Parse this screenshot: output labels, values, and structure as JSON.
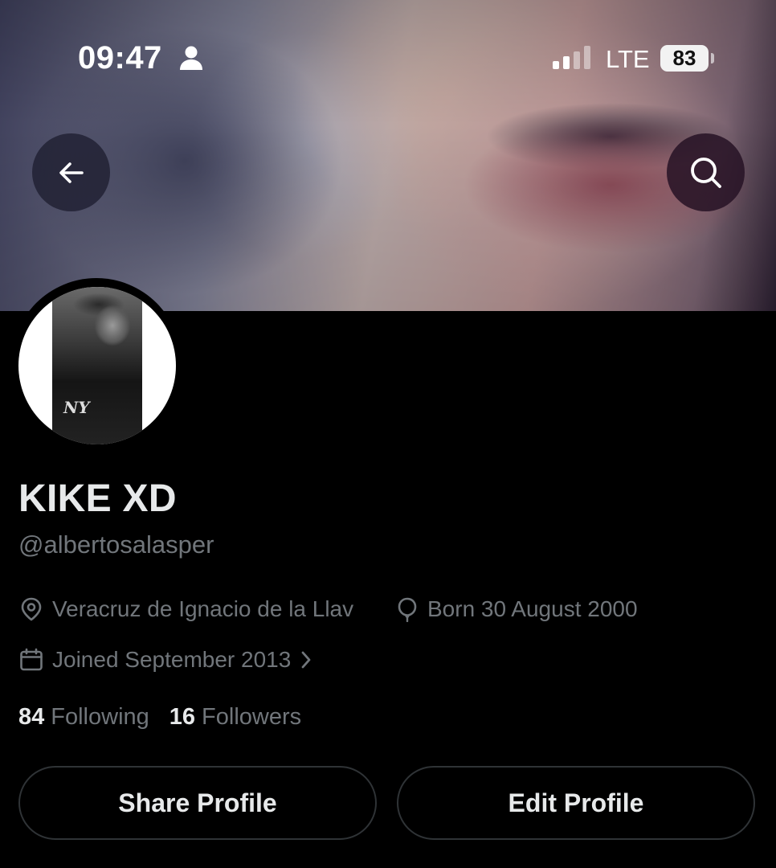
{
  "status_bar": {
    "time": "09:47",
    "network": "LTE",
    "battery": "83"
  },
  "icons": {
    "back": "arrow-left-icon",
    "search": "search-icon",
    "location": "location-pin-icon",
    "birthday": "balloon-icon",
    "joined": "calendar-icon",
    "person": "person-icon",
    "signal": "signal-icon"
  },
  "profile": {
    "display_name": "KIKE XD",
    "handle": "@albertosalasper",
    "location": "Veracruz de Ignacio de la Llav",
    "born": "Born 30 August 2000",
    "joined": "Joined September 2013"
  },
  "stats": {
    "following_count": "84",
    "following_label": "Following",
    "followers_count": "16",
    "followers_label": "Followers"
  },
  "actions": {
    "share_label": "Share Profile",
    "edit_label": "Edit Profile"
  },
  "avatar_logo": "NY",
  "colors": {
    "background": "#000000",
    "primary_text": "#e7e9ea",
    "secondary_text": "#71767b",
    "button_border": "#2f3336"
  }
}
